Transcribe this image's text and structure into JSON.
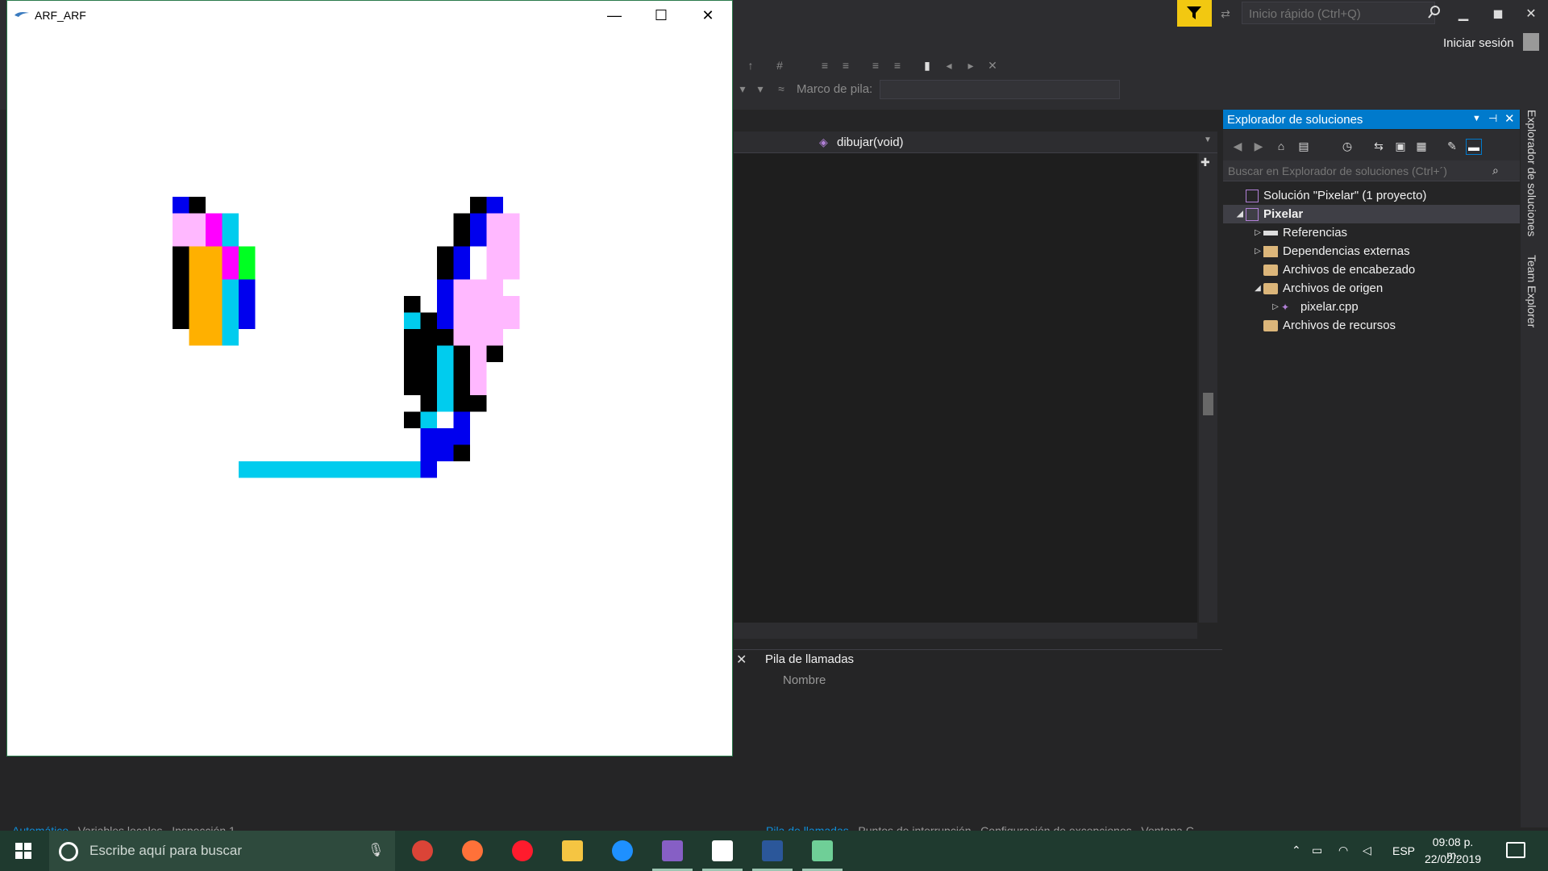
{
  "vs": {
    "quick_launch_placeholder": "Inicio rápido (Ctrl+Q)",
    "sign_in": "Iniciar sesión",
    "stack_frame_label": "Marco de pila:",
    "nav_function": "dibujar(void)",
    "callstack": {
      "title": "Pila de llamadas",
      "column": "Nombre"
    },
    "bottom_tabs_left": [
      "Automático",
      "Variables locales",
      "Inspección 1"
    ],
    "bottom_tabs_right": [
      "Pila de llamadas",
      "Puntos de interrupción",
      "Configuración de excepciones",
      "Ventana C"
    ],
    "side_tabs": [
      "Explorador de soluciones",
      "Team Explorer"
    ]
  },
  "solution_explorer": {
    "title": "Explorador de soluciones",
    "search_placeholder": "Buscar en Explorador de soluciones (Ctrl+´)",
    "tree": [
      {
        "label": "Solución \"Pixelar\"  (1 proyecto)",
        "level": 0,
        "arrow": "",
        "icon": "solution-icon"
      },
      {
        "label": "Pixelar",
        "level": 0,
        "arrow": "◢",
        "icon": "project-icon",
        "selected": true
      },
      {
        "label": "Referencias",
        "level": 1,
        "arrow": "▷",
        "icon": "references-icon"
      },
      {
        "label": "Dependencias externas",
        "level": 1,
        "arrow": "▷",
        "icon": "external-deps-icon"
      },
      {
        "label": "Archivos de encabezado",
        "level": 1,
        "arrow": "",
        "icon": "folder-icon"
      },
      {
        "label": "Archivos de origen",
        "level": 1,
        "arrow": "◢",
        "icon": "folder-icon"
      },
      {
        "label": "pixelar.cpp",
        "level": 2,
        "arrow": "▷",
        "icon": "cpp-file-icon"
      },
      {
        "label": "Archivos de recursos",
        "level": 1,
        "arrow": "",
        "icon": "folder-icon"
      }
    ]
  },
  "app": {
    "title": "ARF_ARF"
  },
  "colors": {
    "black": "#000000",
    "blue": "#0000ee",
    "pink": "#ffb8ff",
    "magenta": "#ff00ff",
    "cyan": "#00ccee",
    "green": "#00ff22",
    "orange": "#ffb000",
    "accent": "#007acc"
  },
  "taskbar": {
    "search_placeholder": "Escribe aquí para buscar",
    "language": "ESP",
    "time": "09:08 p. m.",
    "date": "22/02/2019",
    "apps": [
      "chrome-icon",
      "firefox-icon",
      "opera-icon",
      "file-explorer-icon",
      "edge-icon",
      "visual-studio-icon",
      "photos-icon",
      "word-icon",
      "app-window-icon"
    ]
  }
}
